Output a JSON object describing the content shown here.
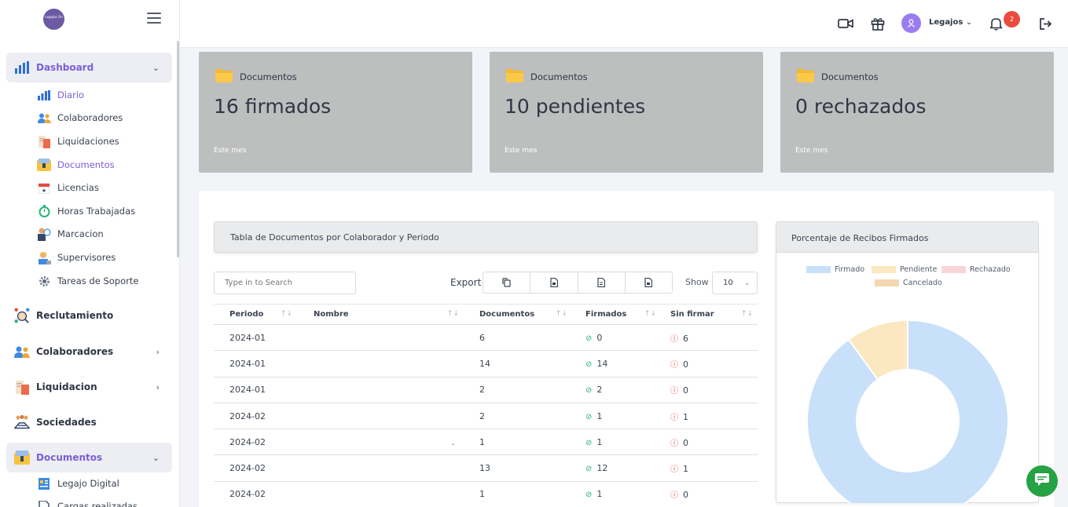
{
  "sidebar": {
    "logo_text": "Legajos On",
    "main_items": [
      {
        "label": "Dashboard"
      },
      {
        "label": "Reclutamiento"
      },
      {
        "label": "Colaboradores"
      },
      {
        "label": "Liquidacion"
      },
      {
        "label": "Sociedades"
      },
      {
        "label": "Documentos"
      }
    ],
    "dashboard_sub": [
      {
        "label": "Diario"
      },
      {
        "label": "Colaboradores"
      },
      {
        "label": "Liquidaciones"
      },
      {
        "label": "Documentos"
      },
      {
        "label": "Licencias"
      },
      {
        "label": "Horas Trabajadas"
      },
      {
        "label": "Marcacion"
      },
      {
        "label": "Supervisores"
      },
      {
        "label": "Tareas de Soporte"
      }
    ],
    "documentos_sub": [
      {
        "label": "Legajo Digital"
      },
      {
        "label": "Cargas realizadas"
      }
    ]
  },
  "header": {
    "user_name": "Legajos",
    "notifications": "2"
  },
  "cards": [
    {
      "label": "Documentos",
      "value": "16 firmados",
      "period": "Este mes"
    },
    {
      "label": "Documentos",
      "value": "10 pendientes",
      "period": "Este mes"
    },
    {
      "label": "Documentos",
      "value": "0 rechazados",
      "period": "Este mes"
    }
  ],
  "table_section": {
    "title": "Tabla de Documentos por Colaborador y Periodo",
    "search_placeholder": "Type in to Search",
    "export_label": "Export",
    "show_label": "Show",
    "show_value": "10",
    "columns": [
      "Periodo",
      "Nombre",
      "Documentos",
      "Firmados",
      "Sin firmar"
    ],
    "rows": [
      {
        "periodo": "2024-01",
        "nombre": "",
        "documentos": "6",
        "firmados": "0",
        "sin_firmar": "6"
      },
      {
        "periodo": "2024-01",
        "nombre": "",
        "documentos": "14",
        "firmados": "14",
        "sin_firmar": "0"
      },
      {
        "periodo": "2024-01",
        "nombre": "",
        "documentos": "2",
        "firmados": "2",
        "sin_firmar": "0"
      },
      {
        "periodo": "2024-02",
        "nombre": "",
        "documentos": "2",
        "firmados": "1",
        "sin_firmar": "1"
      },
      {
        "periodo": "2024-02",
        "nombre": ".",
        "documentos": "1",
        "firmados": "1",
        "sin_firmar": "0"
      },
      {
        "periodo": "2024-02",
        "nombre": "",
        "documentos": "13",
        "firmados": "12",
        "sin_firmar": "1"
      },
      {
        "periodo": "2024-02",
        "nombre": "",
        "documentos": "1",
        "firmados": "1",
        "sin_firmar": "0"
      }
    ]
  },
  "chart_section": {
    "title": "Porcentaje de Recibos Firmados"
  },
  "chart_data": {
    "type": "pie",
    "categories": [
      "Firmado",
      "Pendiente",
      "Rechazado",
      "Cancelado"
    ],
    "values": [
      90,
      10,
      0,
      0
    ],
    "colors": [
      "#c8e0f9",
      "#fbe8c0",
      "#f9d5d8",
      "#f5d6b3"
    ],
    "donut": true,
    "legend_position": "top"
  }
}
